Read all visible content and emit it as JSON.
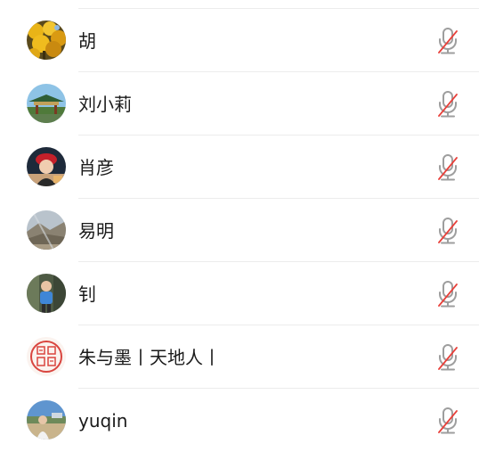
{
  "participants": [
    {
      "name": "胡",
      "avatar_icon": "avatar-golden-leaves",
      "mic_icon": "mic-muted-icon"
    },
    {
      "name": "刘小莉",
      "avatar_icon": "avatar-pavilion-sky",
      "mic_icon": "mic-muted-icon"
    },
    {
      "name": "肖彦",
      "avatar_icon": "avatar-person-red-hat",
      "mic_icon": "mic-muted-icon"
    },
    {
      "name": "易明",
      "avatar_icon": "avatar-hazy-landscape",
      "mic_icon": "mic-muted-icon"
    },
    {
      "name": "钊",
      "avatar_icon": "avatar-child-blue-shirt",
      "mic_icon": "mic-muted-icon"
    },
    {
      "name": "朱与墨丨天地人丨",
      "avatar_icon": "avatar-red-seal",
      "mic_icon": "mic-muted-icon"
    },
    {
      "name": "yuqin",
      "avatar_icon": "avatar-person-outdoors",
      "mic_icon": "mic-muted-icon"
    }
  ],
  "colors": {
    "mic_gray": "#9e9e9e",
    "mute_slash_red": "#e8403a",
    "divider": "#ececec",
    "text": "#1a1a1a"
  }
}
